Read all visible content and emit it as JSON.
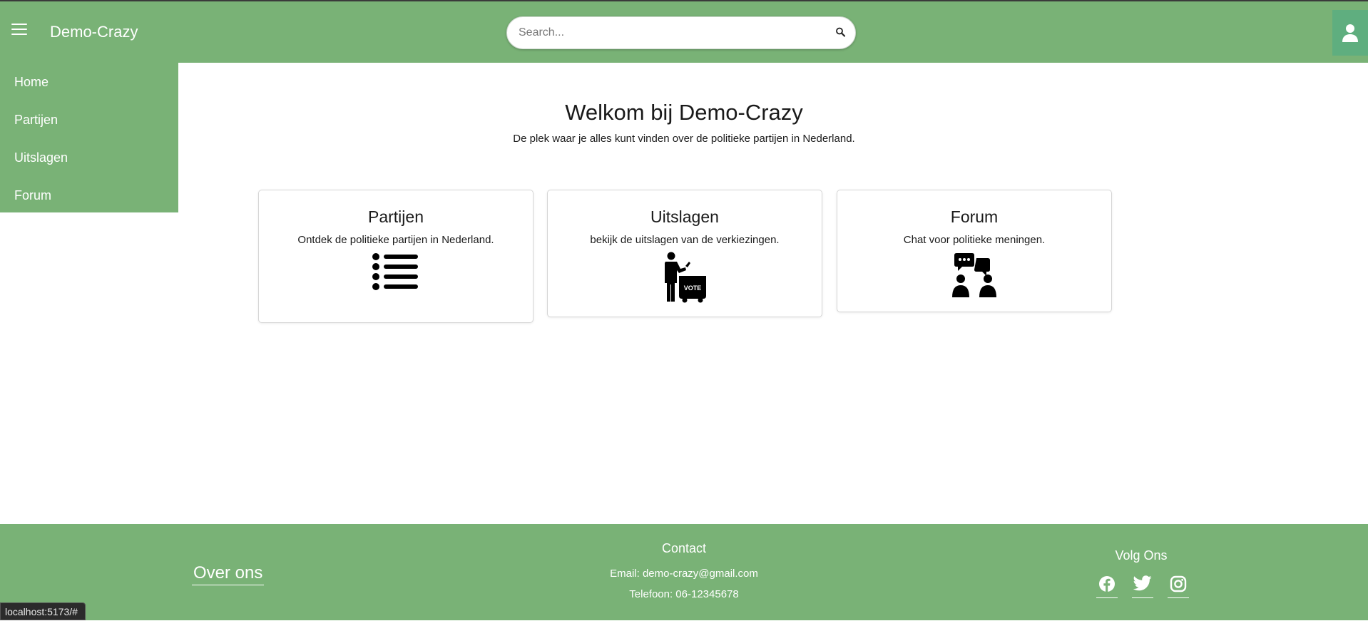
{
  "header": {
    "brand": "Demo-Crazy",
    "search_placeholder": "Search..."
  },
  "sidebar": {
    "items": [
      {
        "label": "Home"
      },
      {
        "label": "Partijen"
      },
      {
        "label": "Uitslagen"
      },
      {
        "label": "Forum"
      }
    ]
  },
  "main": {
    "title": "Welkom bij Demo-Crazy",
    "subtitle": "De plek waar je alles kunt vinden over de politieke partijen in Nederland.",
    "cards": [
      {
        "title": "Partijen",
        "text": "Ontdek de politieke partijen in Nederland.",
        "icon": "list-icon"
      },
      {
        "title": "Uitslagen",
        "text": "bekijk de uitslagen van de verkiezingen.",
        "icon": "voting-person-icon",
        "icon_text": "VOTE"
      },
      {
        "title": "Forum",
        "text": "Chat voor politieke meningen.",
        "icon": "discussion-people-icon"
      }
    ]
  },
  "footer": {
    "about_label": "Over ons",
    "contact_title": "Contact",
    "email": "Email: demo-crazy@gmail.com",
    "phone": "Telefoon: 06-12345678",
    "follow_title": "Volg Ons",
    "socials": [
      "facebook-icon",
      "twitter-icon",
      "instagram-icon"
    ]
  },
  "status_bar": {
    "url": "localhost:5173/#"
  },
  "colors": {
    "primary_green": "#79b276",
    "user_button": "#5fae7f"
  }
}
